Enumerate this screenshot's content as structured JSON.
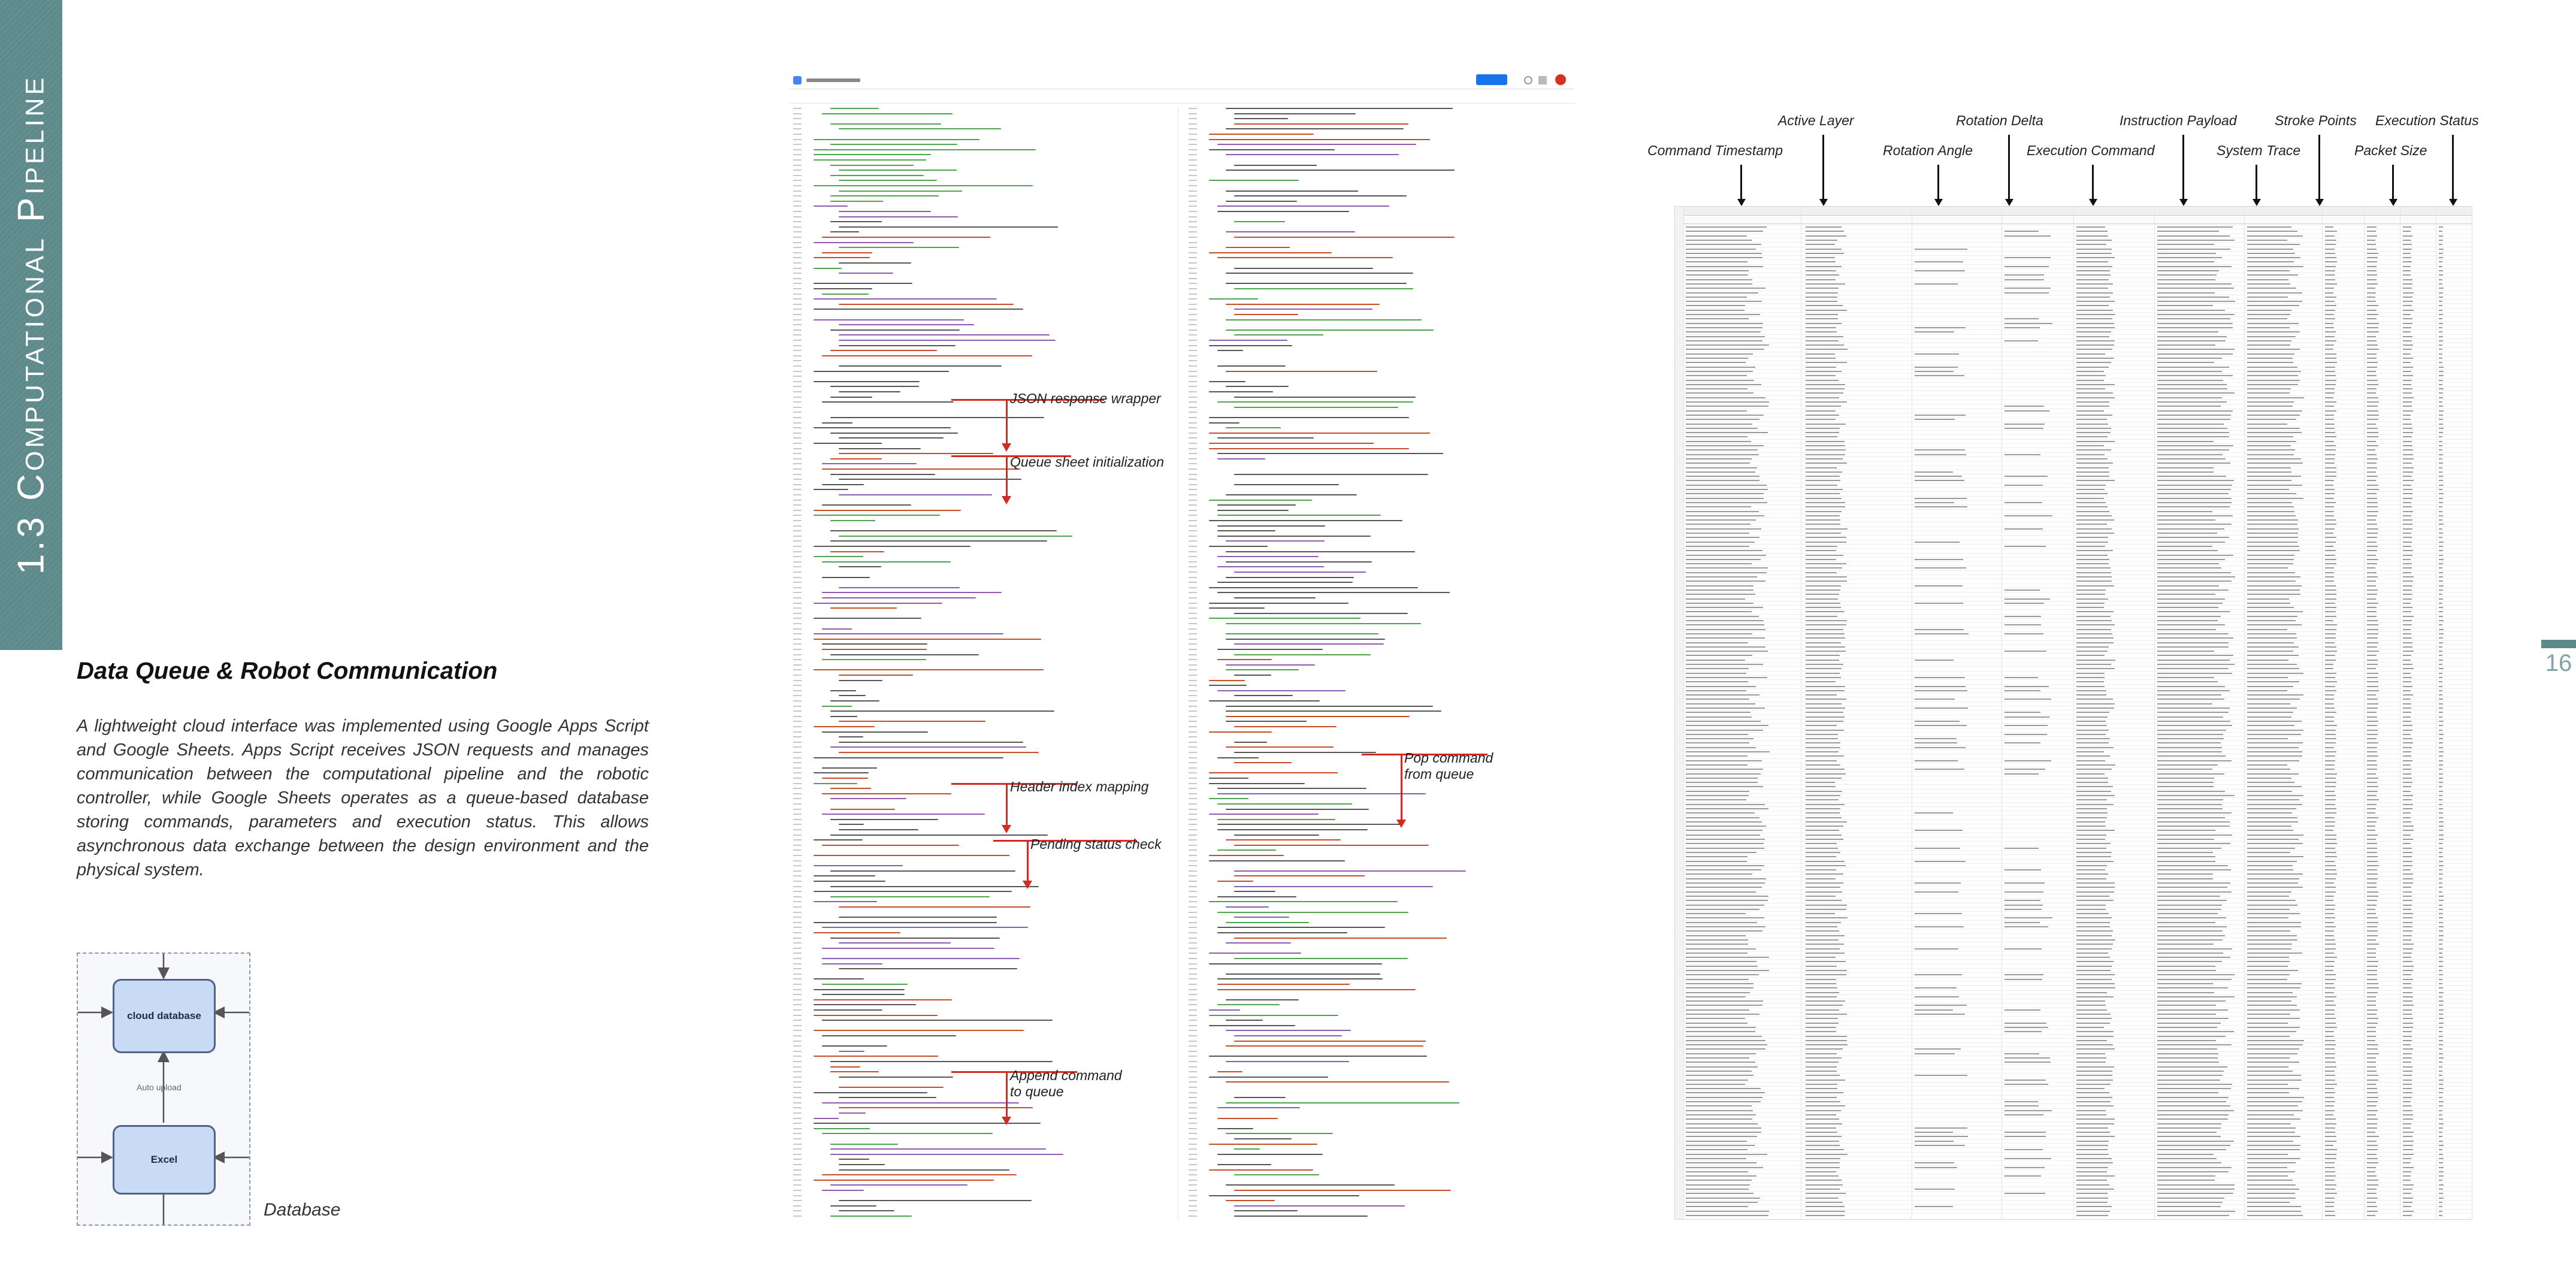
{
  "sidebar": {
    "section_title": "1.3 Computational Pipeline"
  },
  "page_number": "16",
  "section": {
    "title": "Data Queue & Robot Communication",
    "body": "A lightweight cloud interface was implemented using Google Apps Script and Google Sheets. Apps Script receives JSON requests and manages communication between the computational pipeline and the robotic controller, while Google Sheets operates as a queue-based database storing commands, parameters and execution status. This allows asynchronous data exchange between the design environment and the physical system."
  },
  "diagram": {
    "nodes": {
      "cloud": "cloud database",
      "excel": "Excel"
    },
    "edge_label": "Auto upload",
    "caption": "Database"
  },
  "code_annotations": [
    "JSON response wrapper",
    "Queue sheet initialization",
    "Header index mapping",
    "Pending status check",
    "Append command to queue",
    "Pop command from queue"
  ],
  "sheet_columns": [
    "Command Timestamp",
    "Active Layer",
    "Rotation Angle",
    "Rotation Delta",
    "Execution Command",
    "Instruction Payload",
    "System Trace",
    "Stroke Points",
    "Packet Size",
    "Execution Status"
  ],
  "colors": {
    "accent": "#5f8a8c",
    "annotation_red": "#d42a22",
    "diagram_node": "#c9daf4"
  }
}
